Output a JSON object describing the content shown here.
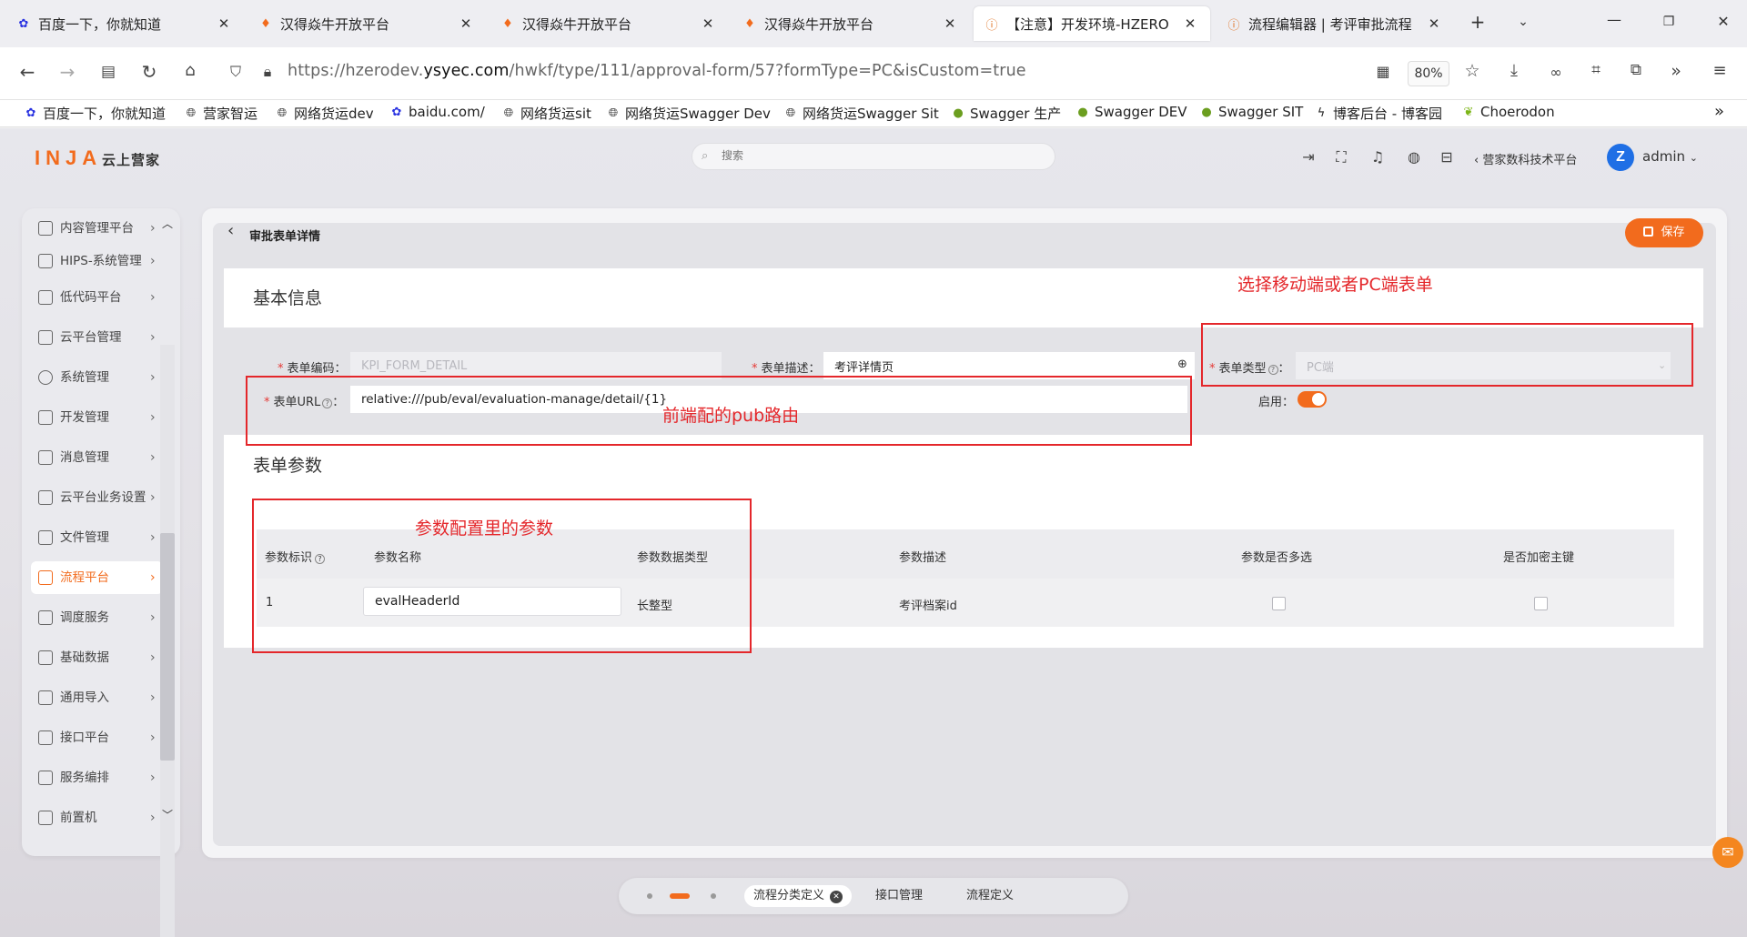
{
  "browser": {
    "tabs": [
      {
        "title": "百度一下，你就知道",
        "icon": "paw-icon",
        "active": false
      },
      {
        "title": "汉得焱牛开放平台",
        "icon": "flame-icon",
        "active": false
      },
      {
        "title": "汉得焱牛开放平台",
        "icon": "flame-icon",
        "active": false
      },
      {
        "title": "汉得焱牛开放平台",
        "icon": "flame-icon",
        "active": false
      },
      {
        "title": "【注意】开发环境-HZERO",
        "icon": "warning-icon",
        "active": true
      },
      {
        "title": "流程编辑器 | 考评审批流程",
        "icon": "warning-icon",
        "active": false
      }
    ],
    "url_prefix": "https://hzerodev.",
    "url_domain": "ysyec.com",
    "url_path": "/hwkf/type/111/approval-form/57?formType=PC&isCustom=true",
    "zoom": "80%",
    "bookmarks": [
      {
        "label": "百度一下，你就知道",
        "icon": "paw-icon"
      },
      {
        "label": "营家智运",
        "icon": "globe-icon"
      },
      {
        "label": "网络货运dev",
        "icon": "globe-icon"
      },
      {
        "label": "baidu.com/",
        "icon": "paw-icon"
      },
      {
        "label": "网络货运sit",
        "icon": "globe-icon"
      },
      {
        "label": "网络货运Swagger Dev",
        "icon": "globe-icon"
      },
      {
        "label": "网络货运Swagger Sit",
        "icon": "globe-icon"
      },
      {
        "label": "Swagger 生产",
        "icon": "swagger-icon"
      },
      {
        "label": "Swagger DEV",
        "icon": "swagger-icon"
      },
      {
        "label": "Swagger SIT",
        "icon": "swagger-icon"
      },
      {
        "label": "博客后台 - 博客园",
        "icon": "blog-icon"
      },
      {
        "label": "Choerodon",
        "icon": "leaf-icon"
      }
    ]
  },
  "app": {
    "logo": "INJA",
    "logo_sub": "云上营家",
    "search_placeholder": "搜索",
    "tenant": "营家数科技术平台",
    "user": "admin",
    "avatar_letter": "Z"
  },
  "sidebar": {
    "items": [
      {
        "label": "内容管理平台",
        "active": false
      },
      {
        "label": "HIPS-系统管理",
        "active": false
      },
      {
        "label": "低代码平台",
        "active": false
      },
      {
        "label": "云平台管理",
        "active": false
      },
      {
        "label": "系统管理",
        "active": false
      },
      {
        "label": "开发管理",
        "active": false
      },
      {
        "label": "消息管理",
        "active": false
      },
      {
        "label": "云平台业务设置",
        "active": false
      },
      {
        "label": "文件管理",
        "active": false
      },
      {
        "label": "流程平台",
        "active": true
      },
      {
        "label": "调度服务",
        "active": false
      },
      {
        "label": "基础数据",
        "active": false
      },
      {
        "label": "通用导入",
        "active": false
      },
      {
        "label": "接口平台",
        "active": false
      },
      {
        "label": "服务编排",
        "active": false
      },
      {
        "label": "前置机",
        "active": false
      }
    ]
  },
  "page": {
    "title": "审批表单详情",
    "save_label": "保存",
    "basic_section": "基本信息",
    "params_section": "表单参数",
    "form": {
      "code_label": "表单编码",
      "code_value": "KPI_FORM_DETAIL",
      "desc_label": "表单描述",
      "desc_value": "考评详情页",
      "type_label": "表单类型",
      "type_value": "PC端",
      "url_label": "表单URL",
      "url_value": "relative:///pub/eval/evaluation-manage/detail/{1}",
      "enabled_label": "启用",
      "enabled": true
    },
    "table": {
      "headers": [
        "参数标识",
        "参数名称",
        "参数数据类型",
        "参数描述",
        "参数是否多选",
        "是否加密主键"
      ],
      "rows": [
        {
          "id": "1",
          "name": "evalHeaderId",
          "type": "长整型",
          "desc": "考评档案id",
          "multi": false,
          "encrypt": false
        }
      ]
    }
  },
  "annotations": {
    "type_note": "选择移动端或者PC端表单",
    "url_note": "前端配的pub路由",
    "params_note": "参数配置里的参数"
  },
  "bottom_tabs": [
    {
      "label": "流程分类定义",
      "active": true,
      "closable": true
    },
    {
      "label": "接口管理",
      "active": false,
      "closable": false
    },
    {
      "label": "流程定义",
      "active": false,
      "closable": false
    }
  ],
  "colors": {
    "brand": "#f26b1d",
    "annotation": "#e4272b"
  }
}
